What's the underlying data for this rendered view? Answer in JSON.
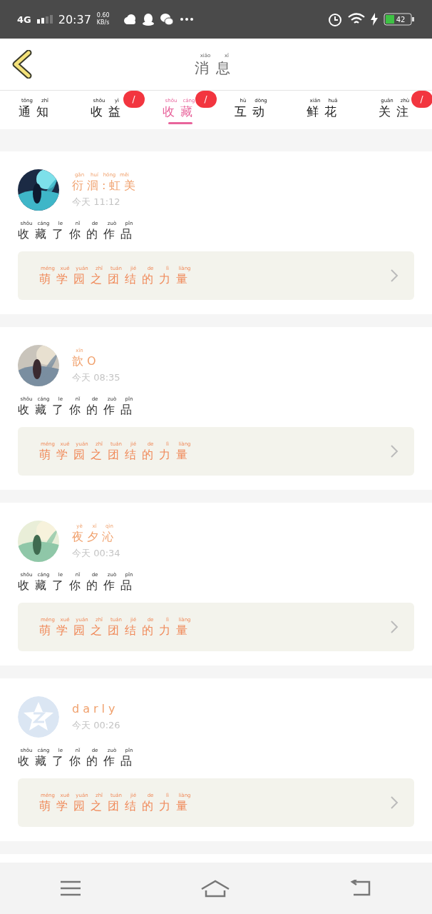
{
  "status_bar": {
    "network": "4G",
    "time": "20:37",
    "speed": "0.60",
    "speed_unit": "KB/s",
    "battery": "42"
  },
  "header": {
    "title": "消息",
    "title_pinyin": "xiāo xī"
  },
  "tabs": [
    {
      "label": "通知",
      "pinyin": "tōng zhī",
      "selected": false
    },
    {
      "label": "收益",
      "pinyin": "shōu yì",
      "selected": false,
      "badge": "/"
    },
    {
      "label": "收藏",
      "pinyin": "shōu cáng",
      "selected": true,
      "badge": "/"
    },
    {
      "label": "互动",
      "pinyin": "hù dòng",
      "selected": false
    },
    {
      "label": "鲜花",
      "pinyin": "xiān huā",
      "selected": false
    },
    {
      "label": "关注",
      "pinyin": "guān zhù",
      "selected": false,
      "badge": "/"
    }
  ],
  "messages": [
    {
      "kind": "picture",
      "name": "衍洄:虹美",
      "name_pinyin": "gǎn huí hóng měi",
      "time": "今天 11:12",
      "text": "收藏了你的作品",
      "text_pinyin": "shōu cáng le nǐ de zuò pǐn",
      "work": "萌学园之团结的力量",
      "work_pinyin": "méng xué yuán zhī tuán jié de lì liàng"
    },
    {
      "kind": "picture",
      "name": "歆O",
      "name_pinyin": "xīn",
      "time": "今天 08:35",
      "text": "收藏了你的作品",
      "text_pinyin": "shōu cáng le nǐ de zuò pǐn",
      "work": "萌学园之团结的力量",
      "work_pinyin": "méng xué yuán zhī tuán jié de lì liàng"
    },
    {
      "kind": "picture",
      "name": "夜夕沁",
      "name_pinyin": "yè xī qìn",
      "time": "今天 00:34",
      "text": "收藏了你的作品",
      "text_pinyin": "shōu cáng le nǐ de zuò pǐn",
      "work": "萌学园之团结的力量",
      "work_pinyin": "méng xué yuán zhī tuán jié de lì liàng"
    },
    {
      "kind": "default",
      "name": "darly",
      "time": "今天 00:26",
      "text": "收藏了你的作品",
      "text_pinyin": "shōu cáng le nǐ de zuò pǐn",
      "work": "萌学园之团结的力量",
      "work_pinyin": "méng xué yuán zhī tuán jié de lì liàng"
    }
  ]
}
